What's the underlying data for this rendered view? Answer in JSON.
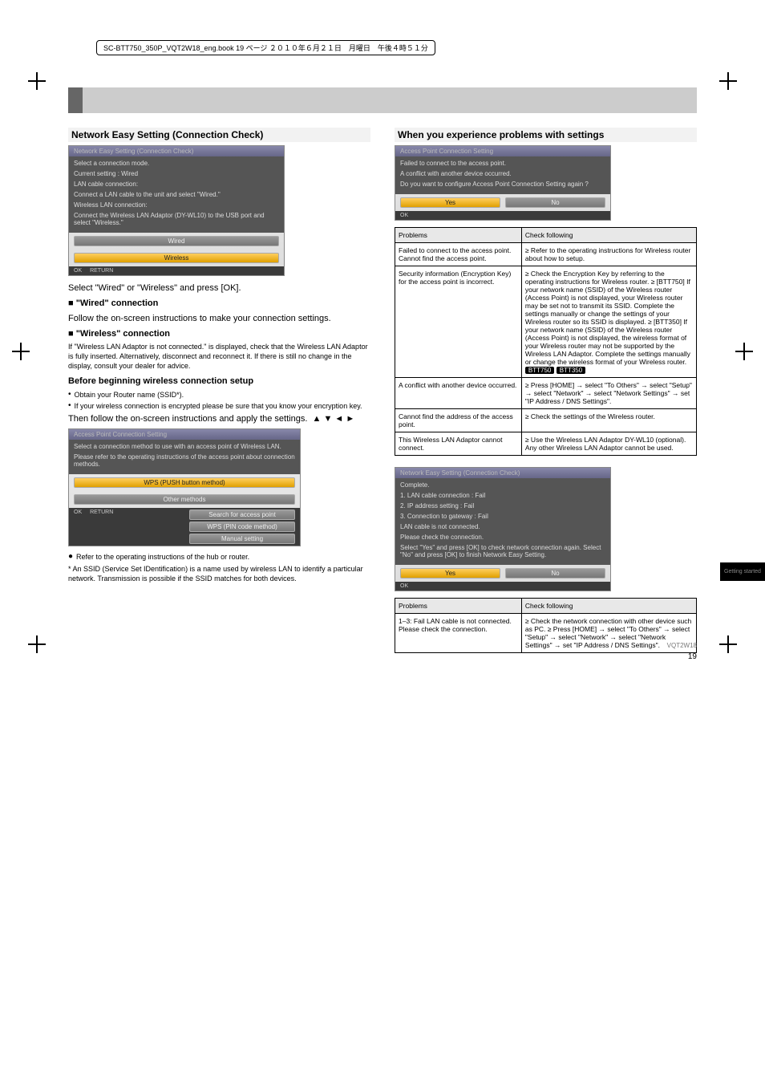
{
  "header": {
    "running": "SC-BTT750_350P_VQT2W18_eng.book  19 ページ  ２０１０年６月２１日　月曜日　午後４時５１分"
  },
  "left": {
    "subhead": "Network Easy Setting (Connection Check)",
    "dlg1": {
      "title": "Network Easy Setting (Connection Check)",
      "l1": "Select a connection mode.",
      "l2": "Current setting            :   Wired",
      "l3": "LAN cable connection:",
      "l4": "Connect a LAN cable to the unit and select \"Wired.\"",
      "l5": "Wireless LAN connection:",
      "l6": "Connect the Wireless LAN Adaptor (DY-WL10) to the USB port and select \"Wireless.\"",
      "btn1": "Wired",
      "btn2": "Wireless",
      "foot1": "OK",
      "foot2": "RETURN"
    },
    "p1": "Select \"Wired\" or \"Wireless\" and press [OK].",
    "wired_h": "■ \"Wired\" connection",
    "wired_p": "Follow the on-screen instructions to make your connection settings.",
    "wless_h": "■ \"Wireless\" connection",
    "wless_p1": "If \"Wireless LAN Adaptor is not connected.\" is displayed, check that the Wireless LAN Adaptor is fully inserted. Alternatively, disconnect and reconnect it. If there is still no change in the display, consult your dealer for advice.",
    "wless_p2": "Before beginning wireless connection setup",
    "wless_b1": "Obtain your Router name (SSID*).",
    "wless_b2": "If your wireless connection is encrypted please be sure that you know your encryption key.",
    "wless_p3": "Then follow the on-screen instructions and apply the settings.",
    "dlg2": {
      "title": "Access Point Connection Setting",
      "l1": "Select a connection method to use with an access point of Wireless LAN.",
      "l2": "Please refer to the operating instructions of the access point about connection methods.",
      "btn1": "WPS (PUSH button method)",
      "btn2": "Other methods",
      "sub_btn1": "Search for access point",
      "sub_btn2": "WPS (PIN code method)",
      "sub_btn3": "Manual setting",
      "foot1": "OK",
      "foot2": "RETURN"
    },
    "foot_note": "Refer to the operating instructions of the hub or router.",
    "star_note": "* An SSID (Service Set IDentification) is a name used by wireless LAN to identify a particular network. Transmission is possible if the SSID matches for both devices."
  },
  "right_top": {
    "dlg": {
      "title": "Access Point Connection Setting",
      "l1": "Failed to connect to the access point.",
      "l2": "A conflict with another device occurred.",
      "l3": "Do you want to configure Access Point Connection Setting again ?",
      "yes": "Yes",
      "no": "No",
      "foot1": "OK"
    },
    "tbl_problems": "Problems",
    "tbl_check": "Check following",
    "rows": [
      {
        "p": "Failed to connect to the access point.\nCannot find the access point.",
        "c": "≥ Refer to the operating instructions for Wireless router about how to setup."
      },
      {
        "p": "Security information (Encryption Key) for the access point is incorrect.",
        "c": "≥ Check the Encryption Key by referring to the operating instructions for Wireless router.\n≥ [BTT750] If your network name (SSID) of the Wireless router (Access Point) is not displayed, your Wireless router may be set not to transmit its SSID. Complete the settings manually or change the settings of your Wireless router so its SSID is displayed.\n≥ [BTT350] If your network name (SSID) of the Wireless router (Access Point) is not displayed, the wireless format of your Wireless router may not be supported by the Wireless LAN Adaptor. Complete the settings manually or change the wireless format of your Wireless router."
      },
      {
        "p": "A conflict with another device occurred.",
        "c": "≥ Press [HOME] → select \"To Others\" → select \"Setup\" → select \"Network\" → select \"Network Settings\" → set \"IP Address / DNS Settings\"."
      },
      {
        "p": "Cannot find the address of the access point.",
        "c": "≥ Check the settings of the Wireless router."
      },
      {
        "p": "This Wireless LAN Adaptor cannot connect.",
        "c": "≥ Use the Wireless LAN Adaptor DY-WL10 (optional). Any other Wireless LAN Adaptor cannot be used."
      }
    ],
    "glyph_arrows": "▲ ▼ ◄ ►"
  },
  "right_bottom": {
    "dlg": {
      "title": "Network Easy Setting (Connection Check)",
      "l1": "Complete.",
      "r1": "1. LAN cable connection         : Fail",
      "r2": "2. IP address setting               : Fail",
      "r3": "3. Connection to gateway       : Fail",
      "l2": "LAN cable is not connected.",
      "l3": "Please check the connection.",
      "l4": "Select \"Yes\" and press [OK] to check network connection again. Select \"No\" and press [OK] to finish Network Easy Setting.",
      "yes": "Yes",
      "no": "No",
      "foot1": "OK"
    },
    "tbl_problems": "Problems",
    "tbl_check": "Check following",
    "rows": [
      {
        "p": "1–3: Fail\nLAN cable is not connected. Please check the connection.",
        "c": "≥ Check the network connection with other device such as PC.\n≥ Press [HOME] → select \"To Others\" → select \"Setup\" → select \"Network\" → select \"Network Settings\" → set \"IP Address / DNS Settings\"."
      }
    ]
  },
  "side_tab": "Getting started",
  "footer": {
    "vqt": "VQT2W18",
    "page": "19"
  }
}
